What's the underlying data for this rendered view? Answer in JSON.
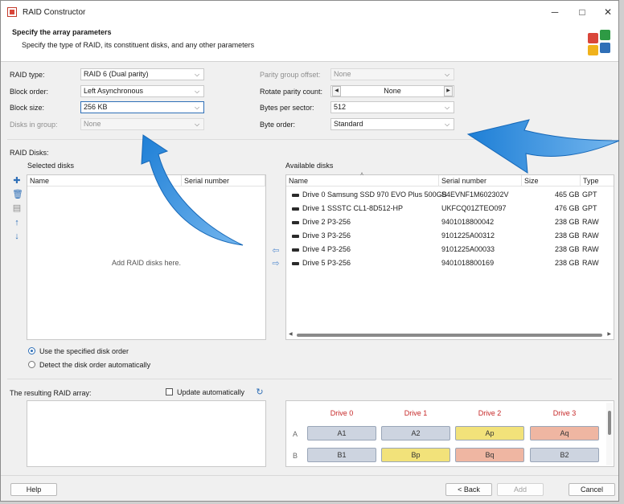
{
  "window": {
    "title": "RAID Constructor"
  },
  "header": {
    "title": "Specify the array parameters",
    "subtitle": "Specify the type of RAID, its constituent disks, and any other parameters"
  },
  "params": {
    "raid_type": {
      "label": "RAID type:",
      "value": "RAID 6 (Dual parity)"
    },
    "block_order": {
      "label": "Block order:",
      "value": "Left Asynchronous"
    },
    "block_size": {
      "label": "Block size:",
      "value": "256 KB"
    },
    "disks_in_group": {
      "label": "Disks in group:",
      "value": "None"
    },
    "parity_group_offset": {
      "label": "Parity group offset:",
      "value": "None"
    },
    "rotate_parity_count": {
      "label": "Rotate parity count:",
      "value": "None"
    },
    "bytes_per_sector": {
      "label": "Bytes per sector:",
      "value": "512"
    },
    "byte_order": {
      "label": "Byte order:",
      "value": "Standard"
    }
  },
  "raid_disks": {
    "label": "RAID Disks:",
    "selected": {
      "label": "Selected disks",
      "columns": [
        "Name",
        "Serial number"
      ],
      "empty_text": "Add RAID disks here."
    },
    "available": {
      "label": "Available disks",
      "columns": [
        "Name",
        "Serial number",
        "Size",
        "Type"
      ],
      "rows": [
        {
          "name": "Drive 0 Samsung SSD 970 EVO Plus 500GB",
          "serial": "S4EVNF1M602302V",
          "size": "465 GB",
          "type": "GPT"
        },
        {
          "name": "Drive 1 SSSTC CL1-8D512-HP",
          "serial": "UKFCQ01ZTEO097",
          "size": "476 GB",
          "type": "GPT"
        },
        {
          "name": "Drive 2 P3-256",
          "serial": "9401018800042",
          "size": "238 GB",
          "type": "RAW"
        },
        {
          "name": "Drive 3 P3-256",
          "serial": "9101225A00312",
          "size": "238 GB",
          "type": "RAW"
        },
        {
          "name": "Drive 4 P3-256",
          "serial": "9101225A00033",
          "size": "238 GB",
          "type": "RAW"
        },
        {
          "name": "Drive 5 P3-256",
          "serial": "9401018800169",
          "size": "238 GB",
          "type": "RAW"
        }
      ]
    },
    "order_options": {
      "specified": "Use the specified disk order",
      "auto": "Detect the disk order automatically"
    }
  },
  "result": {
    "label": "The resulting RAID array:",
    "update_label": "Update automatically",
    "drives": [
      "Drive 0",
      "Drive 1",
      "Drive 2",
      "Drive 3"
    ],
    "rows": [
      {
        "label": "A",
        "cells": [
          "A1",
          "A2",
          "Ap",
          "Aq"
        ]
      },
      {
        "label": "B",
        "cells": [
          "B1",
          "Bp",
          "Bq",
          "B2"
        ]
      }
    ],
    "cell_colors": {
      "data": "#cdd4e0",
      "p": "#f2e27a",
      "q": "#efb6a2"
    }
  },
  "buttons": {
    "help": "Help",
    "back": "< Back",
    "add": "Add",
    "cancel": "Cancel"
  },
  "colors": {
    "accent": "#2f6fb7",
    "drive_header": "#c62828",
    "overlay_arrow": "#1e7fd6"
  }
}
